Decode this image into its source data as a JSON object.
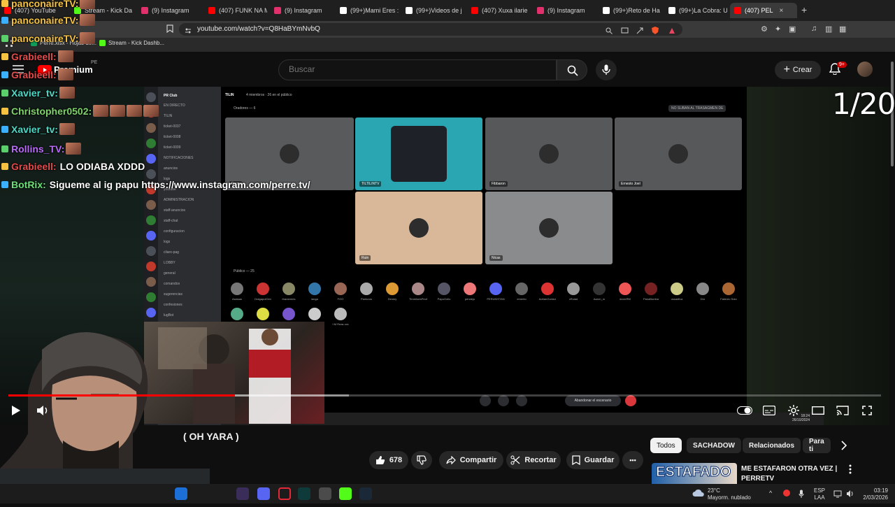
{
  "browser": {
    "tabs": [
      {
        "label": "(407) YouTube",
        "color": "#ff0000"
      },
      {
        "label": "Stream - Kick Da",
        "color": "#53fc18"
      },
      {
        "label": "(9) Instagram",
        "color": "#e1306c"
      },
      {
        "label": "(407) FUNK NA M",
        "color": "#ff0000"
      },
      {
        "label": "(9) Instagram",
        "color": "#e1306c"
      },
      {
        "label": "(99+)Mami Eres :",
        "color": "#ffffff"
      },
      {
        "label": "(99+)Videos de j",
        "color": "#ffffff"
      },
      {
        "label": "(407) Xuxa ilarie",
        "color": "#ff0000"
      },
      {
        "label": "(9) Instagram",
        "color": "#e1306c"
      },
      {
        "label": "(99+)Reto de Ha",
        "color": "#ffffff"
      },
      {
        "label": "(99+)La Cobra: U",
        "color": "#ffffff"
      },
      {
        "label": "(407) PEL",
        "color": "#ff0000"
      }
    ],
    "new_tab": "+",
    "url": "youtube.com/watch?v=Q8HaBYmNvbQ",
    "bookmarks": [
      "Perre.xlsx - Hojas de...",
      "Stream - Kick Dashb..."
    ]
  },
  "youtube": {
    "logo_text": "Premium",
    "region": "PE",
    "search_placeholder": "Buscar",
    "create_label": "Crear",
    "notif_count": "9+",
    "video_title": "( OH YARA )",
    "likes": "678",
    "share_label": "Compartir",
    "clip_label": "Recortar",
    "save_label": "Guardar",
    "more_label": "•••",
    "chips": [
      "Todos",
      "SACHADOW",
      "Relacionados",
      "Para ti"
    ],
    "rec_title": "ME ESTAFARON OTRA VEZ | PERRETV",
    "rec_thumb_text": "ESTAFADO",
    "progress_fraction": 0.26,
    "buffer_fraction": 0.39
  },
  "discord": {
    "server_name": "PR Club",
    "stage_name": "TILIN",
    "stage_meta": "4 miembros · 26 en el público",
    "speakers_header": "Oradores — 6",
    "public_header": "Público — 25",
    "notice": "NO SUBAN AL TRASAGMEN DE",
    "leave_button": "Abandonar el escenario",
    "channels": [
      "EN DIRECTO",
      "TILIN",
      "ticket-0037",
      "ticket-0008",
      "ticket-0009",
      "NOTIFICACIONES",
      "anuncios",
      "logs",
      "youtube",
      "ADMINISTRACION",
      "staff-anuncios",
      "staff-chat",
      "configuracion",
      "logs",
      "cliaro-pag",
      "LOBBY",
      "general",
      "comandos",
      "sugerencias",
      "confesiones",
      "lugBot",
      "RELACION"
    ],
    "speakers": [
      {
        "name": "Perre"
      },
      {
        "name": "TILTILINTV"
      },
      {
        "name": "Fibbaron"
      },
      {
        "name": "Ernesto Joel"
      },
      {
        "name": "Ruin"
      },
      {
        "name": "Nicas"
      }
    ],
    "audience": [
      "Asiasas",
      "DragapulOen",
      "tharanmes",
      "ianga",
      "FOO",
      "Pantorus",
      "Dimmy",
      "TimeAsesPeof",
      "PapoGollo",
      "pendejo",
      "PERUKISTAN",
      "emerito",
      "AdrianGomez",
      "xRulad",
      "Aaron_m",
      "dxxxrRM",
      "PanaBomba",
      "ossadilva",
      "Dro",
      "Fabrizio Soto",
      "",
      "",
      "",
      "",
      "f.M Reas ora"
    ],
    "clock": "18:24",
    "date": "26/10/2024"
  },
  "chat": [
    {
      "user": "panconaireTV:",
      "text": "",
      "color": "#f5c242",
      "emotes": 1
    },
    {
      "user": "panconaireTV:",
      "text": "",
      "color": "#f5c242",
      "emotes": 1
    },
    {
      "user": "panconaireTV:",
      "text": "",
      "color": "#f5c242",
      "emotes": 1
    },
    {
      "user": "Grabieell:",
      "text": "",
      "color": "#e34a4a",
      "emotes": 1
    },
    {
      "user": "Grabieell:",
      "text": "",
      "color": "#e34a4a",
      "emotes": 1
    },
    {
      "user": "Xavier_tv:",
      "text": "",
      "color": "#4ed9c7",
      "emotes": 1
    },
    {
      "user": "Christopher0502:",
      "text": "",
      "color": "#7fd36b",
      "emotes": 4
    },
    {
      "user": "Xavier_tv:",
      "text": "",
      "color": "#4ed9c7",
      "emotes": 1
    },
    {
      "user": "Rollins_TV:",
      "text": "",
      "color": "#b86bf5",
      "emotes": 1
    },
    {
      "user": "Grabieell:",
      "text": "LO ODIABA XDDD",
      "color": "#e34a4a",
      "emotes": 0
    },
    {
      "user": "BotRix:",
      "text": "Sigueme al ig papu https://www.instagram.com/perre.tv/",
      "color": "#6ee07a",
      "emotes": 0
    }
  ],
  "overlay": {
    "counter": "1/20"
  },
  "taskbar": {
    "weather_temp": "23°C",
    "weather_desc": "Mayorm. nublado",
    "lang": "ESP",
    "lang2": "LAA",
    "time": "03:19",
    "date": "2/03/2026"
  }
}
